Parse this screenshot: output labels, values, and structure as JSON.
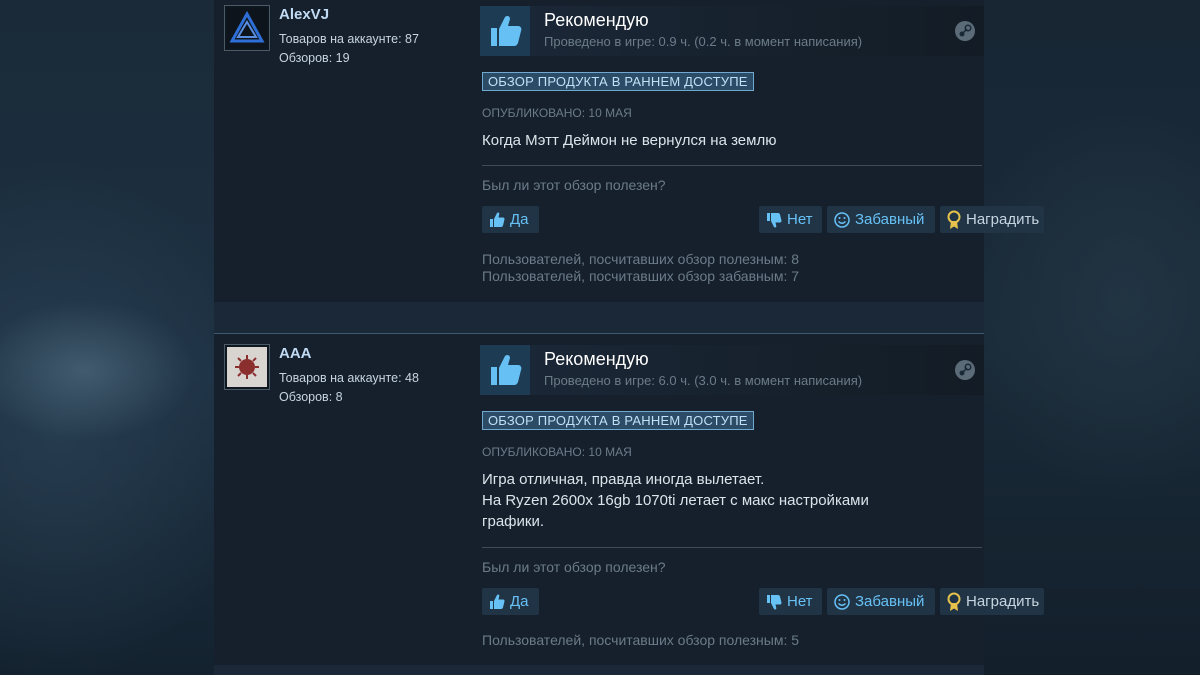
{
  "reviews": [
    {
      "username": "AlexVJ",
      "products_label": "Товаров на аккаунте: 87",
      "reviews_label": "Обзоров: 19",
      "recommendation": "Рекомендую",
      "playtime": "Проведено в игре: 0.9 ч. (0.2 ч. в момент написания)",
      "badge": "ОБЗОР ПРОДУКТА В РАННЕМ ДОСТУПЕ",
      "posted": "ОПУБЛИКОВАНО: 10 МАЯ",
      "text_lines": [
        "Когда Мэтт Деймон не вернулся на землю"
      ],
      "helpful_question": "Был ли этот обзор полезен?",
      "buttons": {
        "yes": "Да",
        "no": "Нет",
        "funny": "Забавный",
        "award": "Наградить"
      },
      "counts": [
        "Пользователей, посчитавших обзор полезным: 8",
        "Пользователей, посчитавших обзор забавным: 7"
      ]
    },
    {
      "username": "AAA",
      "products_label": "Товаров на аккаунте: 48",
      "reviews_label": "Обзоров: 8",
      "recommendation": "Рекомендую",
      "playtime": "Проведено в игре: 6.0 ч. (3.0 ч. в момент написания)",
      "badge": "ОБЗОР ПРОДУКТА В РАННЕМ ДОСТУПЕ",
      "posted": "ОПУБЛИКОВАНО: 10 МАЯ",
      "text_lines": [
        "Игра отличная, правда иногда вылетает.",
        "На Ryzen 2600x 16gb 1070ti летает с макс настройками",
        "графики."
      ],
      "helpful_question": "Был ли этот обзор полезен?",
      "buttons": {
        "yes": "Да",
        "no": "Нет",
        "funny": "Забавный",
        "award": "Наградить"
      },
      "counts": [
        "Пользователей, посчитавших обзор полезным: 5"
      ]
    }
  ],
  "colors": {
    "page_bg": "#1b2838",
    "review_bg": "#16202d",
    "link_blue": "#67c1f5",
    "muted": "#6b7c88",
    "badge_bg": "#2b4b66"
  }
}
